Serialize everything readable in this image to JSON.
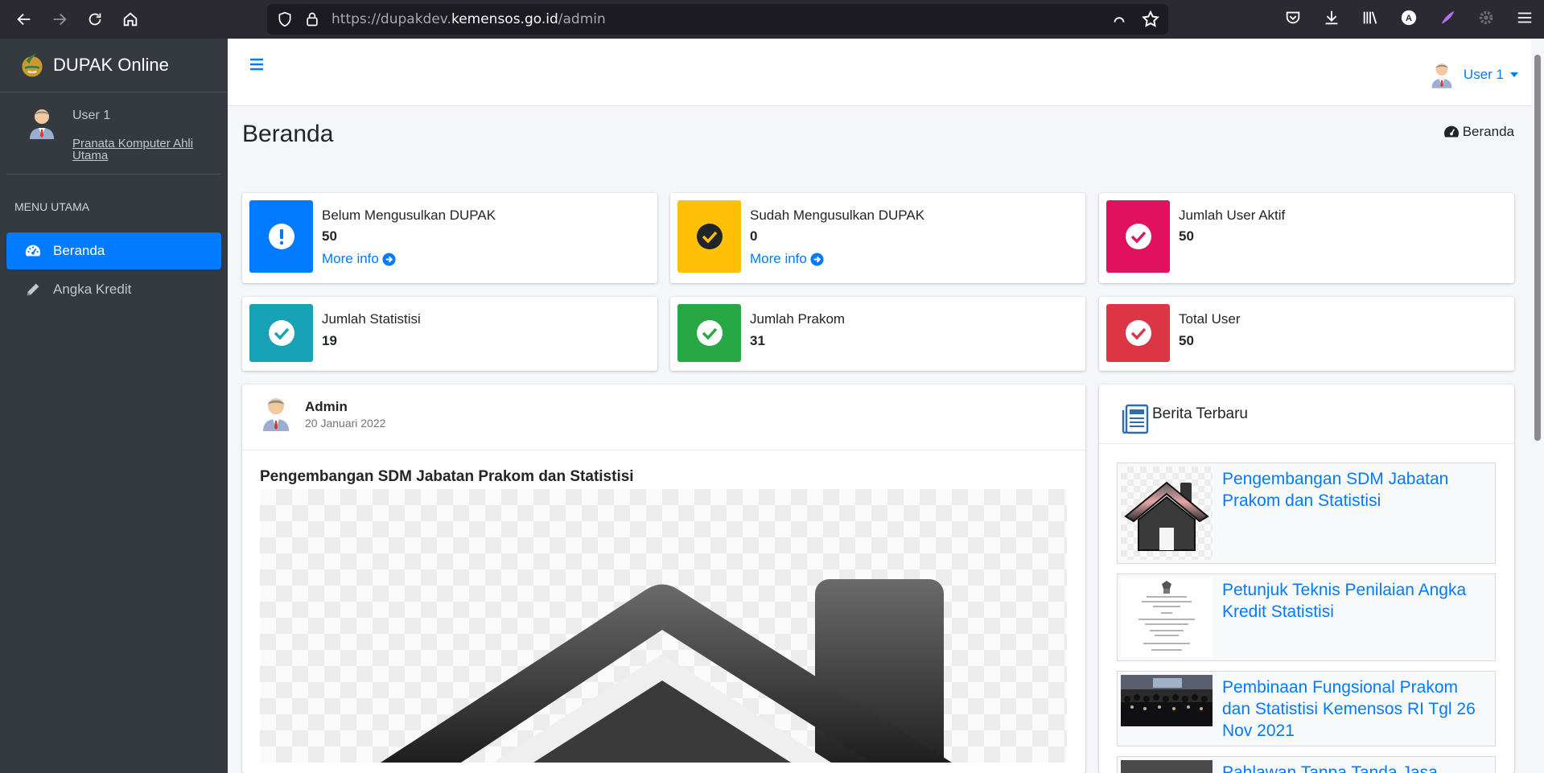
{
  "browser": {
    "url_prefix": "https://dupakdev.",
    "url_domain": "kemensos.go.id",
    "url_path": "/admin",
    "profile_initial": "A"
  },
  "sidebar": {
    "brand": "DUPAK Online",
    "user_name": "User 1",
    "user_role": "Pranata Komputer Ahli Utama",
    "menu_header": "MENU UTAMA",
    "items": [
      {
        "label": "Beranda",
        "icon": "dashboard-icon",
        "active": true
      },
      {
        "label": "Angka Kredit",
        "icon": "pencil-icon",
        "active": false
      }
    ]
  },
  "topnav": {
    "user_label": "User 1"
  },
  "header": {
    "title": "Beranda",
    "breadcrumb": "Beranda"
  },
  "info_boxes": [
    {
      "label": "Belum Mengusulkan DUPAK",
      "value": "50",
      "more": "More info",
      "color": "#007bff",
      "icon": "exclamation-icon"
    },
    {
      "label": "Sudah Mengusulkan DUPAK",
      "value": "0",
      "more": "More info",
      "color": "#ffc107",
      "icon": "check-icon"
    },
    {
      "label": "Jumlah User Aktif",
      "value": "50",
      "color": "#e83e8c",
      "icon": "check-icon"
    },
    {
      "label": "Jumlah Statistisi",
      "value": "19",
      "color": "#17a2b8",
      "icon": "check-icon"
    },
    {
      "label": "Jumlah Prakom",
      "value": "31",
      "color": "#28a745",
      "icon": "check-icon"
    },
    {
      "label": "Total User",
      "value": "50",
      "color": "#dc3545",
      "icon": "check-icon"
    }
  ],
  "post": {
    "author": "Admin",
    "date": "20 Januari 2022",
    "title": "Pengembangan SDM Jabatan Prakom dan Statistisi"
  },
  "news": {
    "title": "Berita Terbaru",
    "items": [
      "Pengembangan SDM Jabatan Prakom dan Statistisi",
      "Petunjuk Teknis Penilaian Angka Kredit Statistisi",
      "Pembinaan Fungsional Prakom dan Statistisi Kemensos RI Tgl 26 Nov 2021",
      "Pahlawan Tanpa Tanda Jasa"
    ]
  }
}
